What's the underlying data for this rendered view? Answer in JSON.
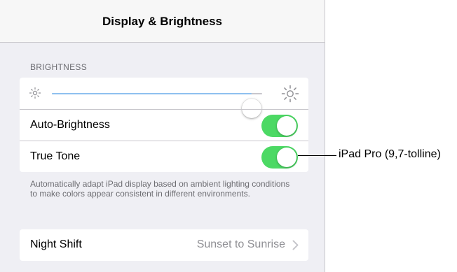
{
  "navbar": {
    "title": "Display & Brightness"
  },
  "brightness": {
    "section_header": "BRIGHTNESS",
    "slider_level": 0.95,
    "icons": {
      "min": "sun-small-icon",
      "max": "sun-large-icon"
    },
    "auto_brightness": {
      "label": "Auto-Brightness",
      "on": true
    },
    "true_tone": {
      "label": "True Tone",
      "on": true
    },
    "footer": "Automatically adapt iPad display based on ambient lighting conditions to make colors appear consistent in different environments."
  },
  "night_shift": {
    "label": "Night Shift",
    "value": "Sunset to Sunrise"
  },
  "callout": {
    "label": "iPad Pro (9,7-tolline)"
  },
  "colors": {
    "toggle_on": "#4cd964",
    "slider_fill": "#8fc0ef",
    "background": "#efeff4"
  }
}
